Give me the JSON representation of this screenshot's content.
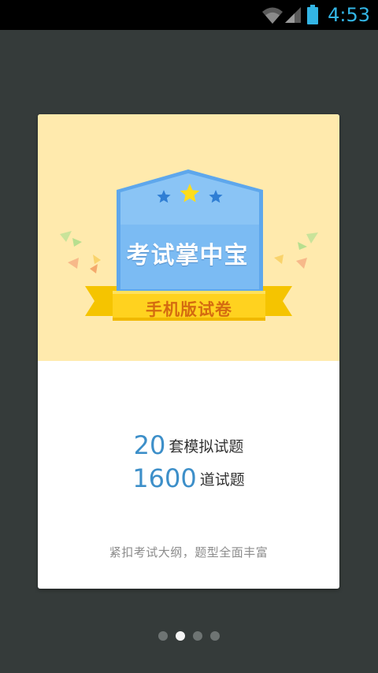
{
  "status_bar": {
    "time": "4:53",
    "icons": [
      "wifi-icon",
      "cell-signal-icon",
      "battery-icon"
    ],
    "time_color": "#33b5e5"
  },
  "card": {
    "badge_title": "考试掌中宝",
    "ribbon_text": "手机版试卷",
    "stats": [
      {
        "number": "20",
        "label": "套模拟试题"
      },
      {
        "number": "1600",
        "label": "道试题"
      }
    ],
    "subtitle": "紧扣考试大纲，题型全面丰富",
    "colors": {
      "top_background": "#ffeaad",
      "badge_blue": "#6aaef0",
      "ribbon_yellow": "#ffd21f",
      "number_blue": "#3d8fc9"
    }
  },
  "pager": {
    "total": 4,
    "active_index": 1
  }
}
